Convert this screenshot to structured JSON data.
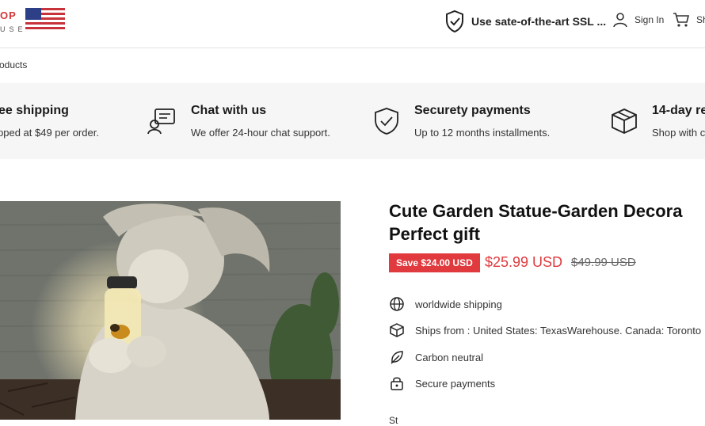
{
  "header": {
    "logo_top": "OP",
    "logo_bottom": "USE",
    "ssl_text": "Use sate-of-the-art SSL ...",
    "signin_label": "Sign In",
    "cart_label": "Sh"
  },
  "breadcrumb": {
    "text": "roducts"
  },
  "features": [
    {
      "title": "ee shipping",
      "desc": "pped at $49 per order.",
      "icon": "truck-icon"
    },
    {
      "title": "Chat with us",
      "desc": "We offer 24-hour chat support.",
      "icon": "chat-icon"
    },
    {
      "title": "Securety payments",
      "desc": "Up to 12 months installments.",
      "icon": "shield-check-icon"
    },
    {
      "title": "14-day re",
      "desc": "Shop with c",
      "icon": "box-icon"
    }
  ],
  "product": {
    "title_line1": "Cute Garden Statue-Garden Decora",
    "title_line2": "Perfect gift",
    "save_badge": "Save $24.00 USD",
    "price": "$25.99 USD",
    "compare_price": "$49.99 USD",
    "info": [
      {
        "icon": "globe-icon",
        "text": "worldwide shipping"
      },
      {
        "icon": "box-icon",
        "text": "Ships from : United States: TexasWarehouse. Canada: Toronto"
      },
      {
        "icon": "leaf-icon",
        "text": "Carbon neutral"
      },
      {
        "icon": "lock-icon",
        "text": "Secure payments"
      }
    ],
    "cutoff_label": "St"
  },
  "colors": {
    "accent": "#e03a3e",
    "band": "#f6f6f6"
  }
}
